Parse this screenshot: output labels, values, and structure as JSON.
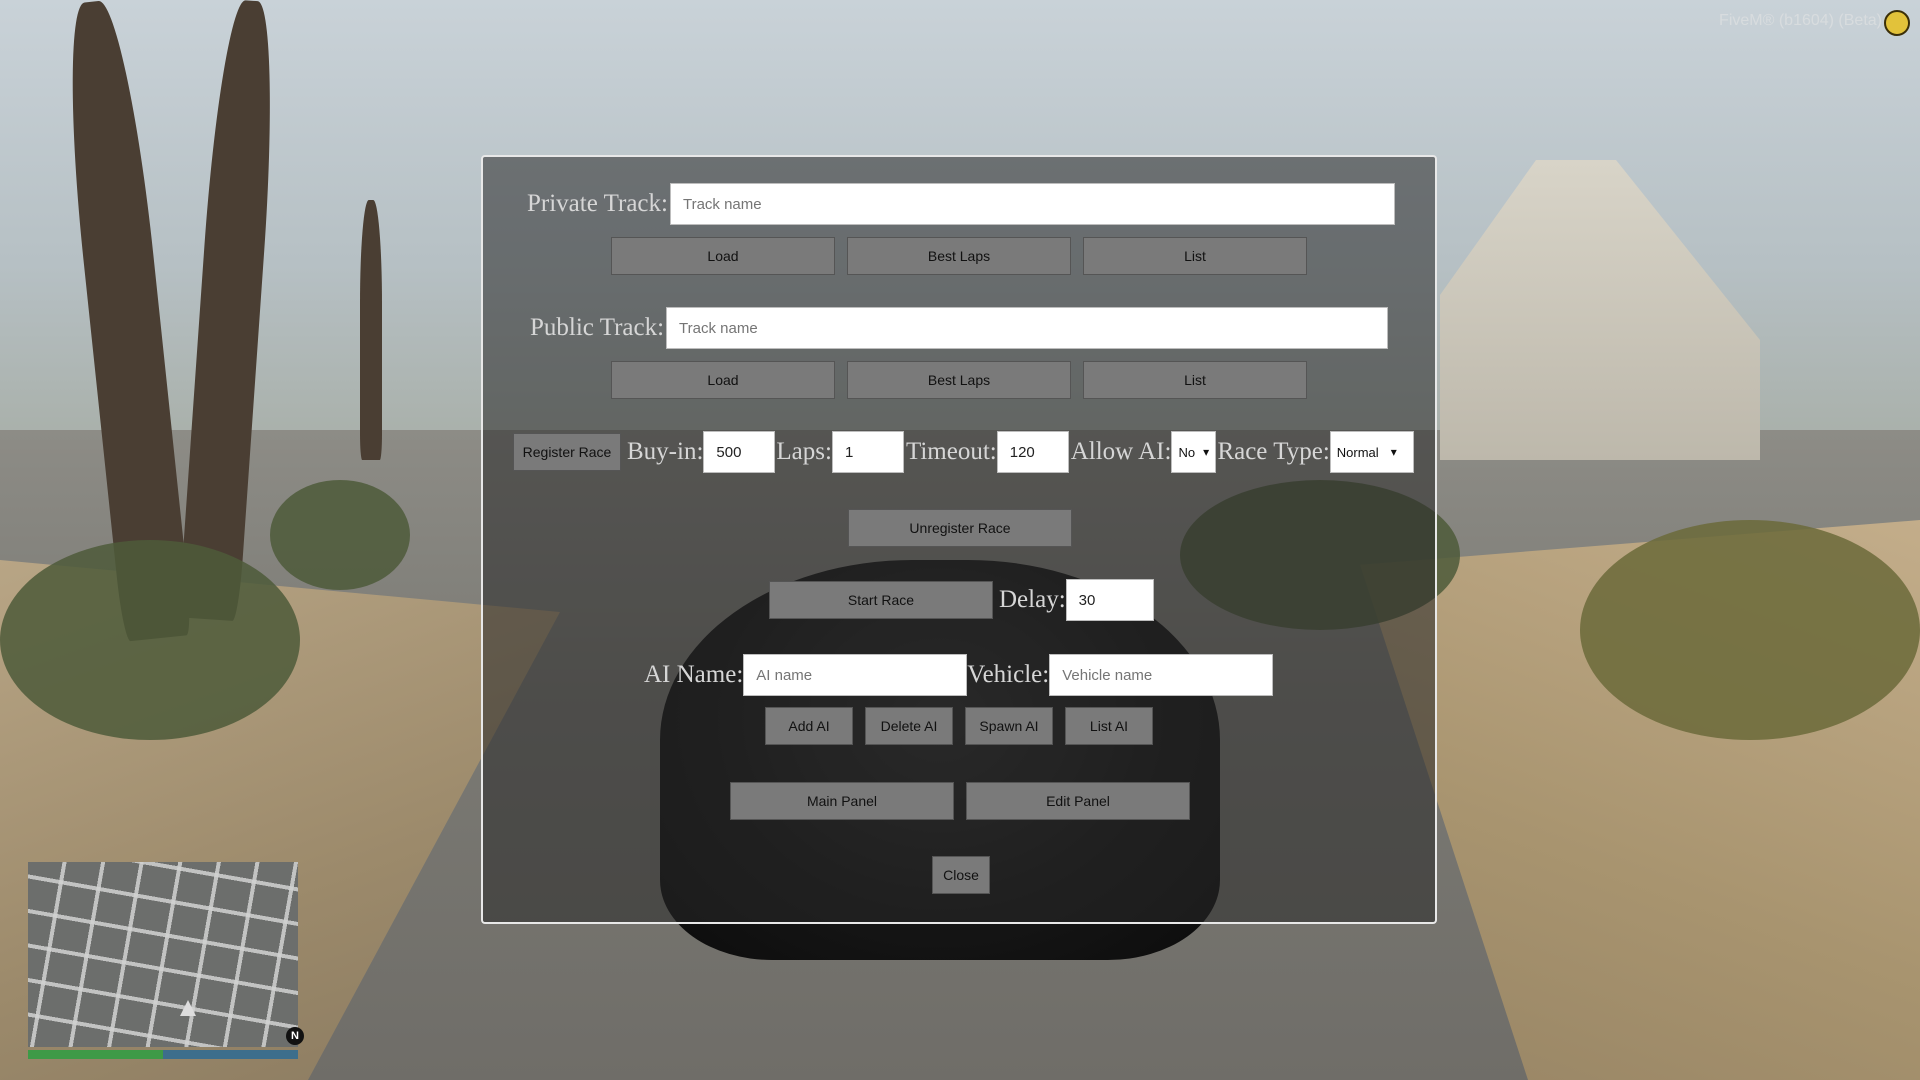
{
  "overlay": {
    "brand": "FiveM® (b1604) (Beta)"
  },
  "private_track": {
    "label": "Private Track:",
    "placeholder": "Track name",
    "load": "Load",
    "best_laps": "Best Laps",
    "list": "List"
  },
  "public_track": {
    "label": "Public Track:",
    "placeholder": "Track name",
    "load": "Load",
    "best_laps": "Best Laps",
    "list": "List"
  },
  "register": {
    "register_button": "Register Race",
    "buyin_label": "Buy-in:",
    "buyin_value": "500",
    "laps_label": "Laps:",
    "laps_value": "1",
    "timeout_label": "Timeout:",
    "timeout_value": "120",
    "allow_ai_label": "Allow AI:",
    "allow_ai_value": "No",
    "race_type_label": "Race Type:",
    "race_type_value": "Normal",
    "unregister_button": "Unregister Race"
  },
  "start": {
    "start_button": "Start Race",
    "delay_label": "Delay:",
    "delay_value": "30"
  },
  "ai": {
    "name_label": "AI Name:",
    "name_placeholder": "AI name",
    "vehicle_label": "Vehicle:",
    "vehicle_placeholder": "Vehicle name",
    "add": "Add AI",
    "delete": "Delete AI",
    "spawn": "Spawn AI",
    "list": "List AI"
  },
  "nav": {
    "main_panel": "Main Panel",
    "edit_panel": "Edit Panel",
    "close": "Close"
  },
  "hud": {
    "compass": "N",
    "health": 0.5,
    "armor": 0.5
  }
}
